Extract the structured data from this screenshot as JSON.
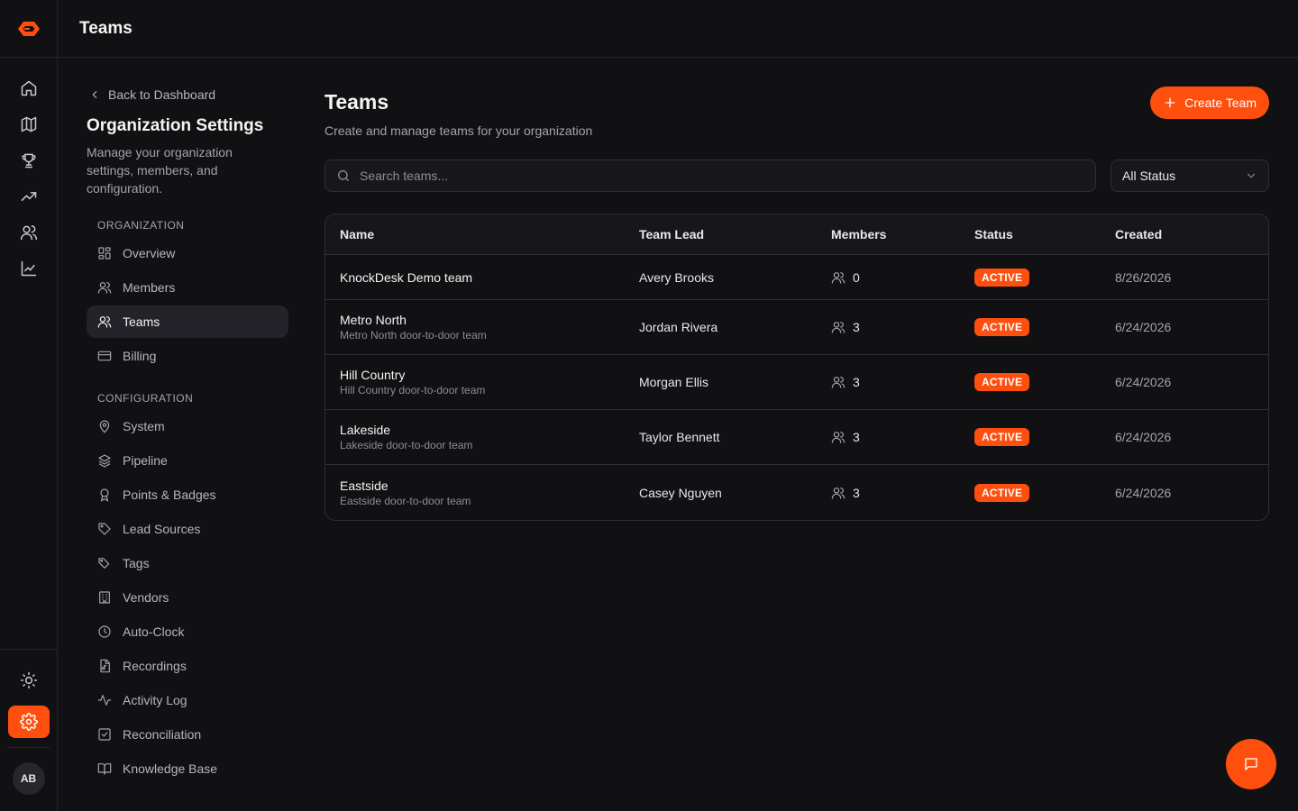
{
  "topbar": {
    "title": "Teams"
  },
  "rail": {
    "items": [
      {
        "icon": "home-icon"
      },
      {
        "icon": "map-icon"
      },
      {
        "icon": "trophy-icon"
      },
      {
        "icon": "trending-up-icon"
      },
      {
        "icon": "users-icon"
      },
      {
        "icon": "chart-line-icon"
      }
    ],
    "bottom": {
      "theme_icon": "sun-icon",
      "settings_icon": "gear-icon",
      "avatar_initials": "AB"
    }
  },
  "sidebar": {
    "back_label": "Back to Dashboard",
    "title": "Organization Settings",
    "description": "Manage your organization settings, members, and configuration.",
    "sections": [
      {
        "label": "ORGANIZATION",
        "items": [
          {
            "label": "Overview",
            "icon": "layout-grid-icon",
            "active": false
          },
          {
            "label": "Members",
            "icon": "user-icon",
            "active": false
          },
          {
            "label": "Teams",
            "icon": "users-icon",
            "active": true
          },
          {
            "label": "Billing",
            "icon": "credit-card-icon",
            "active": false
          }
        ]
      },
      {
        "label": "CONFIGURATION",
        "items": [
          {
            "label": "System",
            "icon": "map-pin-icon"
          },
          {
            "label": "Pipeline",
            "icon": "layers-icon"
          },
          {
            "label": "Points & Badges",
            "icon": "award-icon"
          },
          {
            "label": "Lead Sources",
            "icon": "tag-icon"
          },
          {
            "label": "Tags",
            "icon": "tags-icon"
          },
          {
            "label": "Vendors",
            "icon": "building-icon"
          },
          {
            "label": "Auto-Clock",
            "icon": "clock-icon"
          },
          {
            "label": "Recordings",
            "icon": "file-audio-icon"
          },
          {
            "label": "Activity Log",
            "icon": "activity-icon"
          },
          {
            "label": "Reconciliation",
            "icon": "check-square-icon"
          },
          {
            "label": "Knowledge Base",
            "icon": "book-open-icon"
          }
        ]
      }
    ]
  },
  "main": {
    "title": "Teams",
    "subtitle": "Create and manage teams for your organization",
    "create_button": "Create Team",
    "search_placeholder": "Search teams...",
    "status_filter": "All Status",
    "table": {
      "headers": [
        "Name",
        "Team Lead",
        "Members",
        "Status",
        "Created"
      ],
      "rows": [
        {
          "name": "KnockDesk Demo team",
          "description": "",
          "lead": "Avery Brooks",
          "members": "0",
          "status": "ACTIVE",
          "created": "8/26/2026"
        },
        {
          "name": "Metro North",
          "description": "Metro North door-to-door team",
          "lead": "Jordan Rivera",
          "members": "3",
          "status": "ACTIVE",
          "created": "6/24/2026"
        },
        {
          "name": "Hill Country",
          "description": "Hill Country door-to-door team",
          "lead": "Morgan Ellis",
          "members": "3",
          "status": "ACTIVE",
          "created": "6/24/2026"
        },
        {
          "name": "Lakeside",
          "description": "Lakeside door-to-door team",
          "lead": "Taylor Bennett",
          "members": "3",
          "status": "ACTIVE",
          "created": "6/24/2026"
        },
        {
          "name": "Eastside",
          "description": "Eastside door-to-door team",
          "lead": "Casey Nguyen",
          "members": "3",
          "status": "ACTIVE",
          "created": "6/24/2026"
        }
      ]
    }
  },
  "chat_icon": "message-square-icon",
  "colors": {
    "accent": "#ff4f0e",
    "background": "#111113",
    "surface": "#18181c",
    "border": "#2e2e34"
  }
}
